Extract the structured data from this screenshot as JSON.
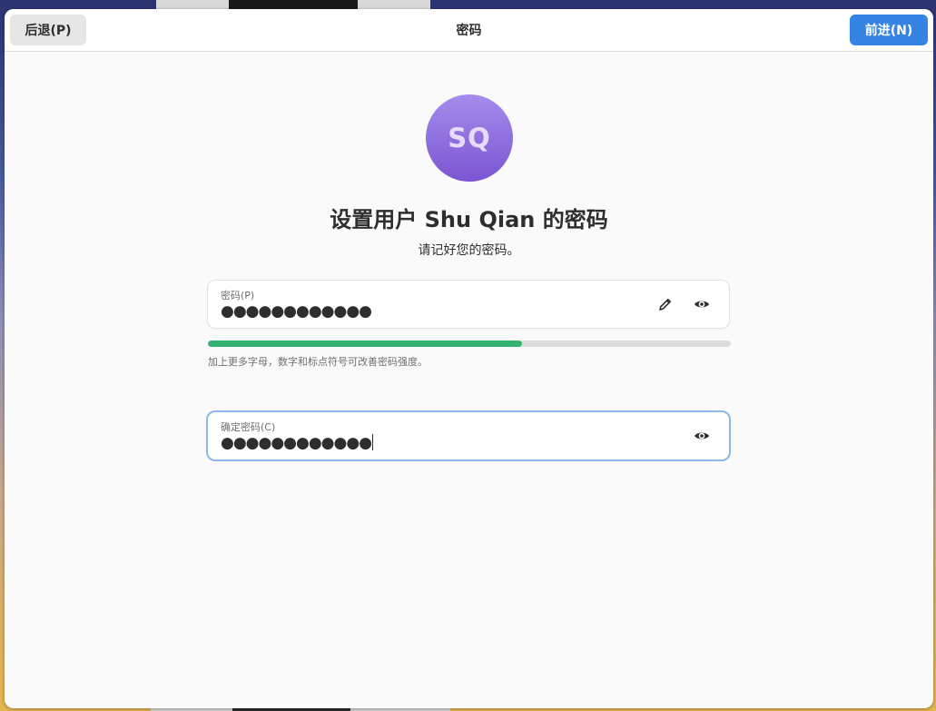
{
  "header": {
    "back_label": "后退(P)",
    "title": "密码",
    "next_label": "前进(N)"
  },
  "user": {
    "initials": "SQ",
    "heading": "设置用户 Shu Qian 的密码",
    "subheading": "请记好您的密码。"
  },
  "password_field": {
    "label": "密码(P)",
    "value": "●●●●●●●●●●●●"
  },
  "strength": {
    "level": 0.6,
    "hint": "加上更多字母，数字和标点符号可改善密码强度。"
  },
  "confirm_field": {
    "label": "确定密码(C)",
    "value": "●●●●●●●●●●●●"
  },
  "icons": {
    "edit": "pencil-icon",
    "reveal": "eye-icon"
  },
  "colors": {
    "accent": "#3584e4",
    "strength_bar": "#33b173",
    "avatar_top": "#a58cec",
    "avatar_bottom": "#7c55d2"
  }
}
